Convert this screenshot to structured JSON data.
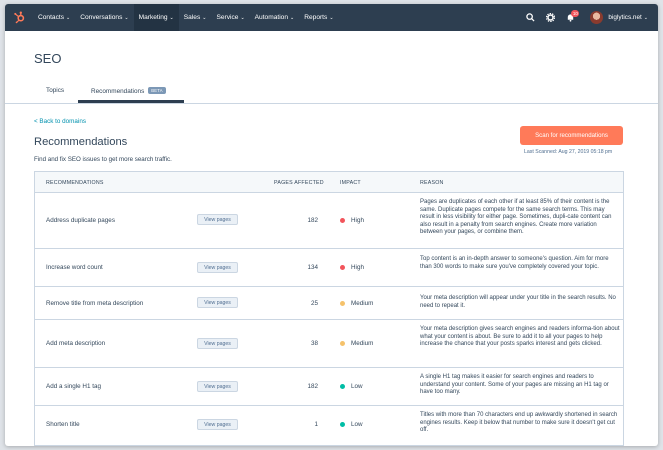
{
  "nav": {
    "items": [
      {
        "label": "Contacts",
        "active": false
      },
      {
        "label": "Conversations",
        "active": false
      },
      {
        "label": "Marketing",
        "active": true
      },
      {
        "label": "Sales",
        "active": false
      },
      {
        "label": "Service",
        "active": false
      },
      {
        "label": "Automation",
        "active": false
      },
      {
        "label": "Reports",
        "active": false
      }
    ],
    "notification_count": "10",
    "account_name": "biglytics.net",
    "icons": [
      "hubspot-logo",
      "search-icon",
      "settings-gear-icon",
      "notifications-bell-icon",
      "avatar"
    ]
  },
  "page": {
    "title": "SEO",
    "tabs": [
      {
        "label": "Topics"
      },
      {
        "label": "Recommendations",
        "badge": "BETA"
      }
    ]
  },
  "section": {
    "back_link": "< Back to domains",
    "title": "Recommendations",
    "subtitle": "Find and fix SEO issues to get more search traffic.",
    "scan_button": "Scan for recommendations",
    "last_scanned": "Last Scanned: Aug 27, 2019 05:18 pm"
  },
  "table": {
    "headers": {
      "recommendations": "RECOMMENDATIONS",
      "pages_affected": "PAGES AFFECTED",
      "impact": "IMPACT",
      "reason": "REASON"
    },
    "view_pages_label": "View pages",
    "rows": [
      {
        "name": "Address duplicate pages",
        "pages": "182",
        "impact": "High",
        "impact_color": "#f2545b",
        "reason": "Pages are duplicates of each other if at least 85% of their content is the same. Duplicate pages compete for the same search terms. This may result in less visibility for either page. Sometimes, dupli-cate content can also result in a penalty from search engines. Create more variation between your pages, or combine them."
      },
      {
        "name": "Increase word count",
        "pages": "134",
        "impact": "High",
        "impact_color": "#f2545b",
        "reason": "Top content is an in-depth answer to someone's question. Aim for more than 300 words to make sure you've completely covered your topic."
      },
      {
        "name": "Remove title from meta description",
        "pages": "25",
        "impact": "Medium",
        "impact_color": "#f5c26b",
        "reason": "Your meta description will appear under your title in the search results. No need to repeat it."
      },
      {
        "name": "Add meta description",
        "pages": "38",
        "impact": "Medium",
        "impact_color": "#f5c26b",
        "reason": "Your meta description gives search engines and readers informa-tion about what your content is about. Be sure to add it to all your pages to help increase the chance that your posts sparks interest and gets clicked."
      },
      {
        "name": "Add a single H1 tag",
        "pages": "182",
        "impact": "Low",
        "impact_color": "#00bda5",
        "reason": "A single H1 tag makes it easier for search engines and readers to understand your content. Some of your pages are missing an H1 tag or have too many."
      },
      {
        "name": "Shorten title",
        "pages": "1",
        "impact": "Low",
        "impact_color": "#00bda5",
        "reason": "Titles with more than 70 characters end up awkwardly shortened in search engines results. Keep it below that number to make sure it doesn't get cut off."
      }
    ]
  }
}
